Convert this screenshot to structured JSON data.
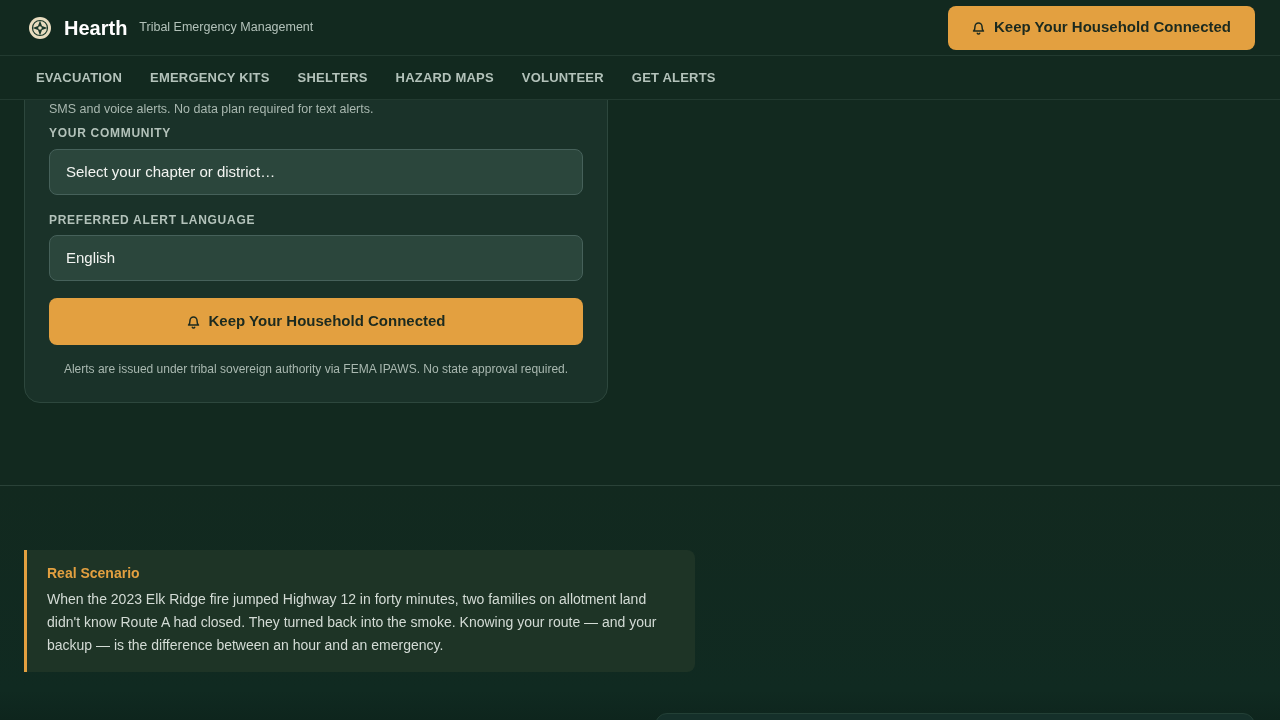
{
  "header": {
    "brand": "Hearth",
    "tagline": "Tribal Emergency Management",
    "cta_button": "Keep Your Household Connected"
  },
  "nav": {
    "items": [
      "EVACUATION",
      "EMERGENCY KITS",
      "SHELTERS",
      "HAZARD MAPS",
      "VOLUNTEER",
      "GET ALERTS"
    ]
  },
  "alert_form": {
    "note": "SMS and voice alerts. No data plan required for text alerts.",
    "fields": [
      {
        "label": "YOUR COMMUNITY",
        "value": "Select your chapter or district…"
      },
      {
        "label": "PREFERRED ALERT LANGUAGE",
        "value": "English"
      }
    ],
    "submit_button": "Keep Your Household Connected",
    "footnote": "Alerts are issued under tribal sovereign authority via FEMA IPAWS. No state approval required."
  },
  "scenario": {
    "title": "Real Scenario",
    "body": "When the 2023 Elk Ridge fire jumped Highway 12 in forty minutes, two families on allotment land didn't know Route A had closed. They turned back into the smoke. Knowing your route — and your backup — is the difference between an hour and an emergency."
  }
}
